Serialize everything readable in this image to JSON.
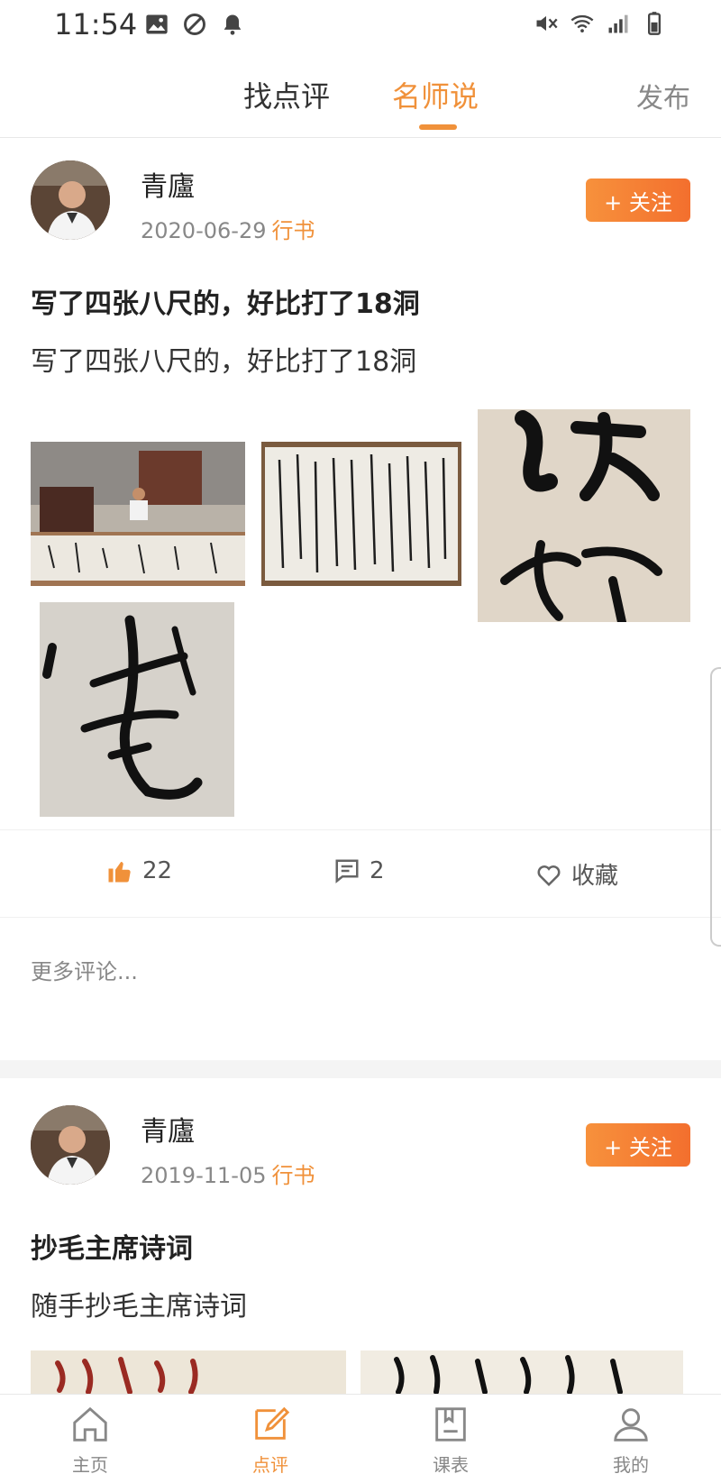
{
  "status_bar": {
    "time": "11:54"
  },
  "top_nav": {
    "tabs": [
      {
        "label": "找点评"
      },
      {
        "label": "名师说",
        "active": true
      }
    ],
    "publish_label": "发布",
    "accent_color": "#f0913a"
  },
  "posts": [
    {
      "author": "青廬",
      "date": "2020-06-29",
      "tag": "行书",
      "follow_label": "+ 关注",
      "title": "写了四张八尺的，好比打了18洞",
      "text": "写了四张八尺的，好比打了18洞",
      "likes": "22",
      "comments": "2",
      "favorite_label": "收藏",
      "more_comments": "更多评论..."
    },
    {
      "author": "青廬",
      "date": "2019-11-05",
      "tag": "行书",
      "follow_label": "+ 关注",
      "title": "抄毛主席诗词",
      "text": "随手抄毛主席诗词"
    }
  ],
  "bottom_nav": {
    "items": [
      {
        "label": "主页",
        "icon": "home-icon"
      },
      {
        "label": "点评",
        "icon": "edit-icon",
        "active": true
      },
      {
        "label": "课表",
        "icon": "schedule-icon"
      },
      {
        "label": "我的",
        "icon": "profile-icon"
      }
    ]
  }
}
